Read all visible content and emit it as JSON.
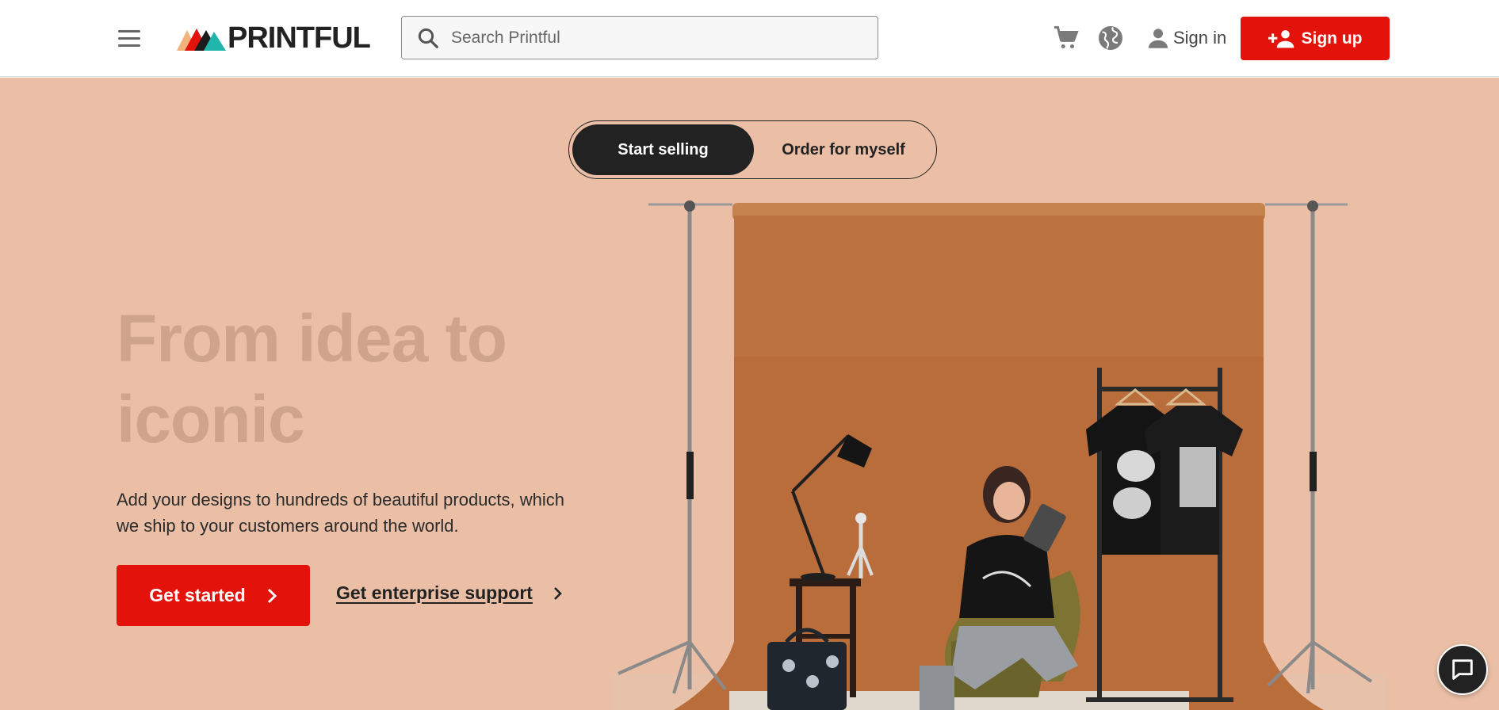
{
  "header": {
    "logo_text": "PRINTFUL",
    "search_placeholder": "Search Printful",
    "signin_label": "Sign in",
    "signup_label": "Sign up",
    "icons": [
      "menu-icon",
      "search-icon",
      "cart-icon",
      "globe-icon",
      "person-icon",
      "add-person-icon"
    ]
  },
  "hero": {
    "toggle": {
      "active_label": "Start selling",
      "inactive_label": "Order for myself"
    },
    "headline": "From idea to iconic",
    "subtext": "Add your designs to hundreds of beautiful products, which we ship to your customers around the world.",
    "cta_primary": "Get started",
    "cta_secondary": "Get enterprise support",
    "image_subject": "woman-reading-tablet-beside-tshirt-rack"
  },
  "colors": {
    "brand_red": "#e3120b",
    "hero_bg": "#eabfa6",
    "backdrop_brown": "#b86d3a",
    "dark": "#222222",
    "headline": "#cfa48d"
  },
  "chat": {
    "icon": "chat-bubble-icon"
  }
}
